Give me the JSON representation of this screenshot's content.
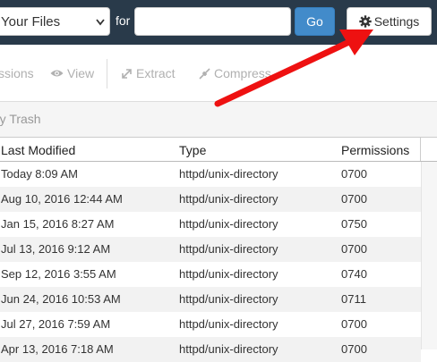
{
  "search": {
    "scope_value": "Your Files",
    "for_label": "for",
    "query_value": "",
    "go_label": "Go"
  },
  "header": {
    "settings_label": "Settings",
    "settings_icon": "gear-icon"
  },
  "toolbar": {
    "items": [
      {
        "label": "ssions",
        "icon": ""
      },
      {
        "label": "View",
        "icon": "eye-icon"
      },
      {
        "label": "Extract",
        "icon": "extract-icon"
      },
      {
        "label": "Compress",
        "icon": "compress-icon"
      }
    ]
  },
  "trash": {
    "label": "pty Trash"
  },
  "table": {
    "columns": [
      "Last Modified",
      "Type",
      "Permissions"
    ],
    "rows": [
      {
        "modified": "Today 8:09 AM",
        "type": "httpd/unix-directory",
        "perms": "0700"
      },
      {
        "modified": "Aug 10, 2016 12:44 AM",
        "type": "httpd/unix-directory",
        "perms": "0700"
      },
      {
        "modified": "Jan 15, 2016 8:27 AM",
        "type": "httpd/unix-directory",
        "perms": "0750"
      },
      {
        "modified": "Jul 13, 2016 9:12 AM",
        "type": "httpd/unix-directory",
        "perms": "0700"
      },
      {
        "modified": "Sep 12, 2016 3:55 AM",
        "type": "httpd/unix-directory",
        "perms": "0740"
      },
      {
        "modified": "Jun 24, 2016 10:53 AM",
        "type": "httpd/unix-directory",
        "perms": "0711"
      },
      {
        "modified": "Jul 27, 2016 7:59 AM",
        "type": "httpd/unix-directory",
        "perms": "0700"
      },
      {
        "modified": "Apr 13, 2016 7:18 AM",
        "type": "httpd/unix-directory",
        "perms": "0700"
      }
    ]
  },
  "colors": {
    "topbar": "#293a4a",
    "go_button": "#428bca",
    "annotation_arrow": "#ee1111"
  }
}
